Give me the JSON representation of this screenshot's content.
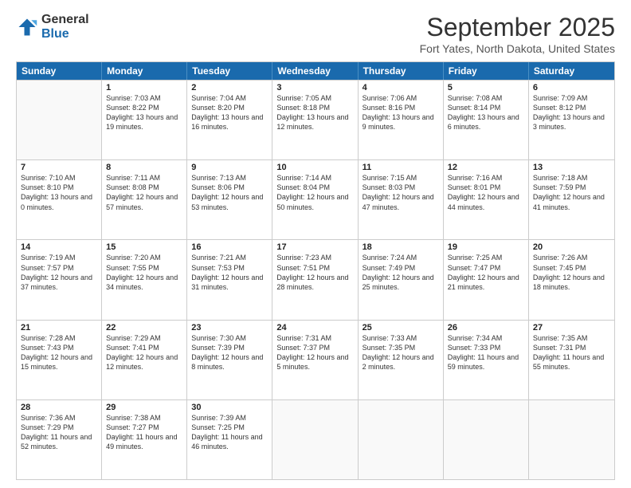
{
  "logo": {
    "general": "General",
    "blue": "Blue"
  },
  "title": "September 2025",
  "location": "Fort Yates, North Dakota, United States",
  "days_of_week": [
    "Sunday",
    "Monday",
    "Tuesday",
    "Wednesday",
    "Thursday",
    "Friday",
    "Saturday"
  ],
  "weeks": [
    [
      {
        "day": "",
        "empty": true
      },
      {
        "day": "1",
        "rise": "Sunrise: 7:03 AM",
        "set": "Sunset: 8:22 PM",
        "light": "Daylight: 13 hours and 19 minutes."
      },
      {
        "day": "2",
        "rise": "Sunrise: 7:04 AM",
        "set": "Sunset: 8:20 PM",
        "light": "Daylight: 13 hours and 16 minutes."
      },
      {
        "day": "3",
        "rise": "Sunrise: 7:05 AM",
        "set": "Sunset: 8:18 PM",
        "light": "Daylight: 13 hours and 12 minutes."
      },
      {
        "day": "4",
        "rise": "Sunrise: 7:06 AM",
        "set": "Sunset: 8:16 PM",
        "light": "Daylight: 13 hours and 9 minutes."
      },
      {
        "day": "5",
        "rise": "Sunrise: 7:08 AM",
        "set": "Sunset: 8:14 PM",
        "light": "Daylight: 13 hours and 6 minutes."
      },
      {
        "day": "6",
        "rise": "Sunrise: 7:09 AM",
        "set": "Sunset: 8:12 PM",
        "light": "Daylight: 13 hours and 3 minutes."
      }
    ],
    [
      {
        "day": "7",
        "rise": "Sunrise: 7:10 AM",
        "set": "Sunset: 8:10 PM",
        "light": "Daylight: 13 hours and 0 minutes."
      },
      {
        "day": "8",
        "rise": "Sunrise: 7:11 AM",
        "set": "Sunset: 8:08 PM",
        "light": "Daylight: 12 hours and 57 minutes."
      },
      {
        "day": "9",
        "rise": "Sunrise: 7:13 AM",
        "set": "Sunset: 8:06 PM",
        "light": "Daylight: 12 hours and 53 minutes."
      },
      {
        "day": "10",
        "rise": "Sunrise: 7:14 AM",
        "set": "Sunset: 8:04 PM",
        "light": "Daylight: 12 hours and 50 minutes."
      },
      {
        "day": "11",
        "rise": "Sunrise: 7:15 AM",
        "set": "Sunset: 8:03 PM",
        "light": "Daylight: 12 hours and 47 minutes."
      },
      {
        "day": "12",
        "rise": "Sunrise: 7:16 AM",
        "set": "Sunset: 8:01 PM",
        "light": "Daylight: 12 hours and 44 minutes."
      },
      {
        "day": "13",
        "rise": "Sunrise: 7:18 AM",
        "set": "Sunset: 7:59 PM",
        "light": "Daylight: 12 hours and 41 minutes."
      }
    ],
    [
      {
        "day": "14",
        "rise": "Sunrise: 7:19 AM",
        "set": "Sunset: 7:57 PM",
        "light": "Daylight: 12 hours and 37 minutes."
      },
      {
        "day": "15",
        "rise": "Sunrise: 7:20 AM",
        "set": "Sunset: 7:55 PM",
        "light": "Daylight: 12 hours and 34 minutes."
      },
      {
        "day": "16",
        "rise": "Sunrise: 7:21 AM",
        "set": "Sunset: 7:53 PM",
        "light": "Daylight: 12 hours and 31 minutes."
      },
      {
        "day": "17",
        "rise": "Sunrise: 7:23 AM",
        "set": "Sunset: 7:51 PM",
        "light": "Daylight: 12 hours and 28 minutes."
      },
      {
        "day": "18",
        "rise": "Sunrise: 7:24 AM",
        "set": "Sunset: 7:49 PM",
        "light": "Daylight: 12 hours and 25 minutes."
      },
      {
        "day": "19",
        "rise": "Sunrise: 7:25 AM",
        "set": "Sunset: 7:47 PM",
        "light": "Daylight: 12 hours and 21 minutes."
      },
      {
        "day": "20",
        "rise": "Sunrise: 7:26 AM",
        "set": "Sunset: 7:45 PM",
        "light": "Daylight: 12 hours and 18 minutes."
      }
    ],
    [
      {
        "day": "21",
        "rise": "Sunrise: 7:28 AM",
        "set": "Sunset: 7:43 PM",
        "light": "Daylight: 12 hours and 15 minutes."
      },
      {
        "day": "22",
        "rise": "Sunrise: 7:29 AM",
        "set": "Sunset: 7:41 PM",
        "light": "Daylight: 12 hours and 12 minutes."
      },
      {
        "day": "23",
        "rise": "Sunrise: 7:30 AM",
        "set": "Sunset: 7:39 PM",
        "light": "Daylight: 12 hours and 8 minutes."
      },
      {
        "day": "24",
        "rise": "Sunrise: 7:31 AM",
        "set": "Sunset: 7:37 PM",
        "light": "Daylight: 12 hours and 5 minutes."
      },
      {
        "day": "25",
        "rise": "Sunrise: 7:33 AM",
        "set": "Sunset: 7:35 PM",
        "light": "Daylight: 12 hours and 2 minutes."
      },
      {
        "day": "26",
        "rise": "Sunrise: 7:34 AM",
        "set": "Sunset: 7:33 PM",
        "light": "Daylight: 11 hours and 59 minutes."
      },
      {
        "day": "27",
        "rise": "Sunrise: 7:35 AM",
        "set": "Sunset: 7:31 PM",
        "light": "Daylight: 11 hours and 55 minutes."
      }
    ],
    [
      {
        "day": "28",
        "rise": "Sunrise: 7:36 AM",
        "set": "Sunset: 7:29 PM",
        "light": "Daylight: 11 hours and 52 minutes."
      },
      {
        "day": "29",
        "rise": "Sunrise: 7:38 AM",
        "set": "Sunset: 7:27 PM",
        "light": "Daylight: 11 hours and 49 minutes."
      },
      {
        "day": "30",
        "rise": "Sunrise: 7:39 AM",
        "set": "Sunset: 7:25 PM",
        "light": "Daylight: 11 hours and 46 minutes."
      },
      {
        "day": "",
        "empty": true
      },
      {
        "day": "",
        "empty": true
      },
      {
        "day": "",
        "empty": true
      },
      {
        "day": "",
        "empty": true
      }
    ]
  ]
}
